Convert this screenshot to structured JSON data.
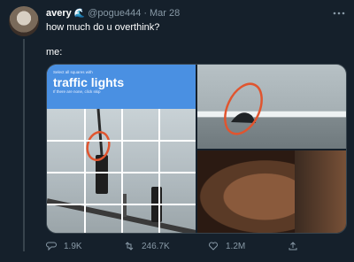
{
  "tweet": {
    "author": {
      "name": "avery",
      "handle": "@pogue444",
      "emoji": "🌊"
    },
    "dot": "·",
    "date": "Mar 28",
    "text": "how much do u overthink?",
    "me_label": "me:"
  },
  "captcha": {
    "instruction": "Select all squares with",
    "title": "traffic lights",
    "note": "If there are none, click skip"
  },
  "actions": {
    "reply_count": "1.9K",
    "retweet_count": "246.7K",
    "like_count": "1.2M"
  },
  "colors": {
    "background": "#15202b",
    "muted": "#8899a6",
    "captcha_blue": "#4a90e2",
    "circle_red": "#e0552f"
  },
  "icons": {
    "more": "more-options-icon",
    "reply": "reply-icon",
    "retweet": "retweet-icon",
    "like": "heart-icon",
    "share": "share-icon"
  }
}
